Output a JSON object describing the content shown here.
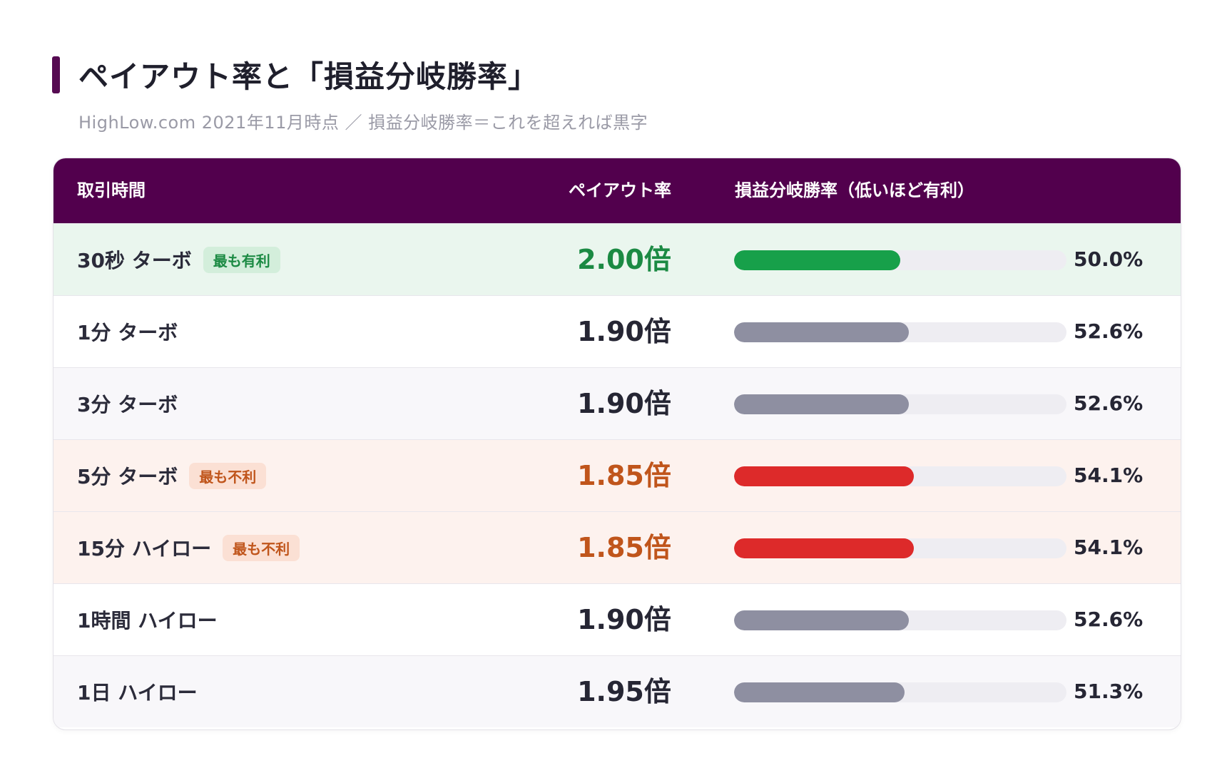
{
  "header": {
    "title": "ペイアウト率と「損益分岐勝率」",
    "subtitle": "HighLow.com 2021年11月時点 ／ 損益分岐勝率＝これを超えれば黒字"
  },
  "table": {
    "columns": [
      "取引時間",
      "ペイアウト率",
      "損益分岐勝率（低いほど有利）"
    ],
    "rows": [
      {
        "label": "30秒 ターボ",
        "badge": "最も有利",
        "payout": "2.00倍",
        "rate": "50.0%",
        "rate_value": 50.0
      },
      {
        "label": "1分 ターボ",
        "badge": "",
        "payout": "1.90倍",
        "rate": "52.6%",
        "rate_value": 52.6
      },
      {
        "label": "3分 ターボ",
        "badge": "",
        "payout": "1.90倍",
        "rate": "52.6%",
        "rate_value": 52.6
      },
      {
        "label": "5分 ターボ",
        "badge": "最も不利",
        "payout": "1.85倍",
        "rate": "54.1%",
        "rate_value": 54.1
      },
      {
        "label": "15分 ハイロー",
        "badge": "最も不利",
        "payout": "1.85倍",
        "rate": "54.1%",
        "rate_value": 54.1
      },
      {
        "label": "1時間 ハイロー",
        "badge": "",
        "payout": "1.90倍",
        "rate": "52.6%",
        "rate_value": 52.6
      },
      {
        "label": "1日 ハイロー",
        "badge": "",
        "payout": "1.95倍",
        "rate": "51.3%",
        "rate_value": 51.3
      }
    ]
  },
  "colors": {
    "brand": "#52004d",
    "good": "#17a04a",
    "bad": "#dd2a2a",
    "neutral": "#8e8fa1"
  }
}
